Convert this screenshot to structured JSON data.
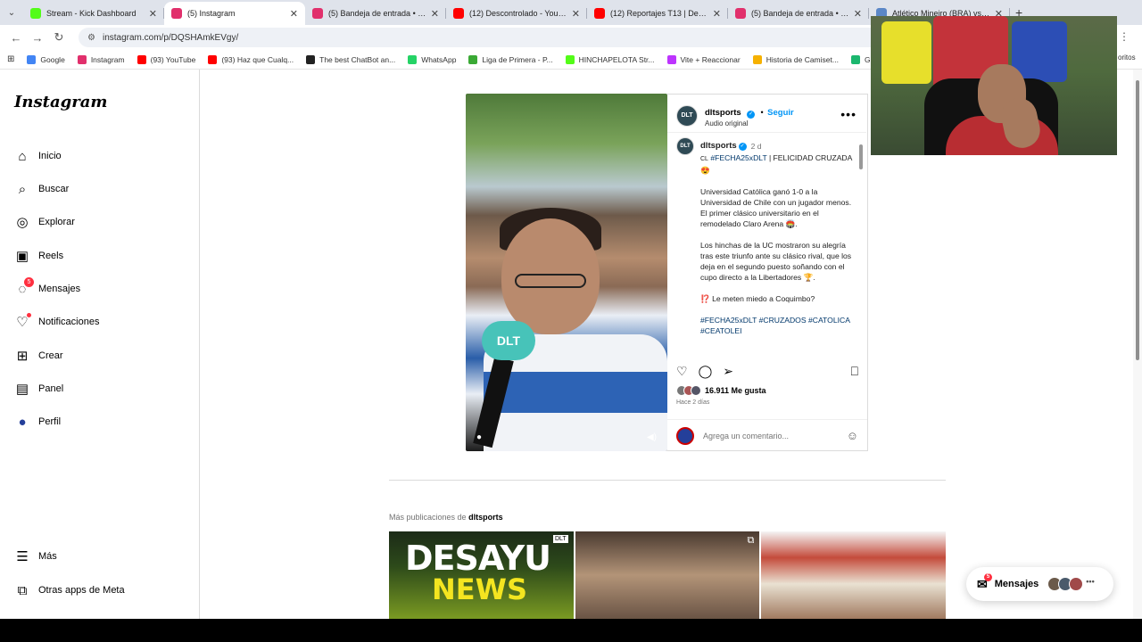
{
  "tabs": [
    {
      "title": "Stream - Kick Dashboard",
      "color": "#53fc18"
    },
    {
      "title": "(5) Instagram",
      "color": "#e1306c",
      "active": true
    },
    {
      "title": "(5) Bandeja de entrada • Chats",
      "color": "#e1306c"
    },
    {
      "title": "(12) Descontrolado - YouTube",
      "color": "#ff0000"
    },
    {
      "title": "(12) Reportajes T13 | Denuncia:",
      "color": "#ff0000"
    },
    {
      "title": "(5) Bandeja de entrada • Chats",
      "color": "#e1306c"
    },
    {
      "title": "Atlético Mineiro (BRA) vs. Indep...",
      "color": "#5b87c7"
    }
  ],
  "address": {
    "url": "instagram.com/p/DQSHAmkEVgy/"
  },
  "bookmarks": [
    {
      "label": "Google",
      "color": "#4285f4"
    },
    {
      "label": "Instagram",
      "color": "#e1306c"
    },
    {
      "label": "(93) YouTube",
      "color": "#ff0000"
    },
    {
      "label": "(93) Haz que Cualq...",
      "color": "#ff0000"
    },
    {
      "label": "The best ChatBot an...",
      "color": "#222222"
    },
    {
      "label": "WhatsApp",
      "color": "#25d366"
    },
    {
      "label": "Liga de Primera - P...",
      "color": "#3aa935"
    },
    {
      "label": "HINCHAPELOTA Str...",
      "color": "#53fc18"
    },
    {
      "label": "Vite + Reaccionar",
      "color": "#bd34fe"
    },
    {
      "label": "Historia de Camiset...",
      "color": "#f6b100"
    },
    {
      "label": "GIF - Imgur",
      "color": "#1bb76e"
    }
  ],
  "bookmarks_overflow": "oritos",
  "sidebar": {
    "logo": "Instagram",
    "items": [
      {
        "label": "Inicio",
        "icon": "home-icon",
        "glyph": "⌂"
      },
      {
        "label": "Buscar",
        "icon": "search-icon",
        "glyph": "⌕"
      },
      {
        "label": "Explorar",
        "icon": "compass-icon",
        "glyph": "◎"
      },
      {
        "label": "Reels",
        "icon": "reels-icon",
        "glyph": "▣"
      },
      {
        "label": "Mensajes",
        "icon": "messenger-icon",
        "glyph": "◌",
        "badge": "5"
      },
      {
        "label": "Notificaciones",
        "icon": "heart-icon",
        "glyph": "♡",
        "dot": true
      },
      {
        "label": "Crear",
        "icon": "plus-square-icon",
        "glyph": "⊞"
      },
      {
        "label": "Panel",
        "icon": "chart-icon",
        "glyph": "▤"
      },
      {
        "label": "Perfil",
        "icon": "profile-avatar-icon",
        "glyph": "●"
      }
    ],
    "footer": [
      {
        "label": "Más",
        "icon": "menu-icon",
        "glyph": "☰"
      },
      {
        "label": "Otras apps de Meta",
        "icon": "meta-apps-icon",
        "glyph": "⧉"
      }
    ]
  },
  "post": {
    "username": "dltsports",
    "follow": "Seguir",
    "audio": "Audio original",
    "avatar_text": "DLT",
    "mic_text": "DLT",
    "age": "2 d",
    "caption_lead": "CL",
    "caption_tag": "#FECHA25xDLT",
    "caption_title": "| FELICIDAD CRUZADA 😍",
    "paragraph1": "Universidad Católica ganó 1-0 a la Universidad de Chile con un jugador menos. El primer clásico universitario en el remodelado Claro Arena 🏟️.",
    "paragraph2": "Los hinchas de la UC mostraron su alegría tras este triunfo ante su clásico rival, que los deja en el segundo puesto soñando con el cupo directo a la Libertadores 🏆.",
    "paragraph3": "⁉️ Le meten miedo a Coquimbo?",
    "hashtags": "#FECHA25xDLT #CRUZADOS #CATOLICA #CEATOLEI",
    "likes": "16.911 Me gusta",
    "posted": "Hace 2 días",
    "comment_placeholder": "Agrega un comentario..."
  },
  "more_posts": {
    "prefix": "Más publicaciones de",
    "user": "dltsports",
    "thumb1_line1": "DESAYU",
    "thumb1_line2": "NEWS",
    "thumb1_badge": "DLT"
  },
  "messages_pill": {
    "label": "Mensajes",
    "badge": "5"
  }
}
